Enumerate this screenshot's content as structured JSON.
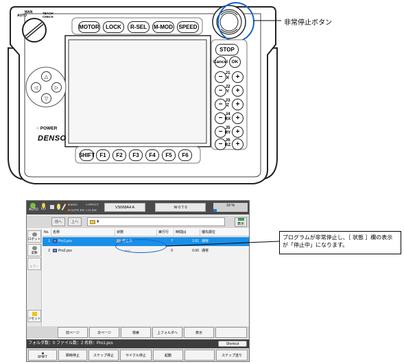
{
  "pendant": {
    "top_keys": [
      "MOTOR",
      "LOCK",
      "R-SEL",
      "M-MOD",
      "SPEED"
    ],
    "fkeys": [
      "SHIFT",
      "F1",
      "F2",
      "F3",
      "F4",
      "F5",
      "F6"
    ],
    "stop": "STOP",
    "cancel": "Cancel",
    "ok": "OK",
    "jog_labels": [
      "J1\nX",
      "J2\nY",
      "J3\nZ",
      "J4\nRX",
      "J5\nRY",
      "J6\nRZ"
    ],
    "power_label": "POWER",
    "brand": "DENSO",
    "mode_labels": {
      "manual": "MAN",
      "auto": "AUTO",
      "teach": "TEACH CHECK"
    },
    "emergency_callout": "非常停止ボタン"
  },
  "screen": {
    "topbar": {
      "auto_label": "AUTO",
      "io_label": "I/O",
      "status": {
        "eng": "ENG",
        "auto_en": "AUTO EN",
        "protect": "PRTCT",
        "dsw": "D.SW"
      },
      "robot_model": "VS068A4 A",
      "tool_work": "W 0 T 0",
      "speed": "10 %",
      "speed_value": 10
    },
    "nav": {
      "back_label": "前へ",
      "up_label": "上へ",
      "path": "¥",
      "display_label": "表示"
    },
    "sidebar": {
      "robot_label": "ロボット",
      "var_label": "変数",
      "error_label": "エラー",
      "reset_label": "リセット"
    },
    "table": {
      "columns": [
        "No.",
        "名称",
        "状態",
        "実行行",
        "時間[s]",
        "優先順位"
      ],
      "rows": [
        {
          "no": "1",
          "name": "Pro1.pcs",
          "state": "停止中",
          "line": "7",
          "time": "2.61",
          "priority": "通常"
        },
        {
          "no": "2",
          "name": "Pro2.pcs",
          "state": "-----",
          "line": "0",
          "time": "0.00",
          "priority": "通常"
        }
      ]
    },
    "func_buttons": [
      "前ページ",
      "次ページ",
      "検索",
      "上フォルダへ",
      "表示"
    ],
    "status_bar": {
      "text": "フォルダ数：0  ファイル数：2  名称：Pro1.pcs",
      "shortcut": "Shortcut"
    },
    "bottom_buttons": {
      "shift": "SHIFT",
      "b1": "瞬時停止",
      "b2": "ステップ停止",
      "b3": "サイクル停止",
      "b4": "起動",
      "b5": "ステップ送り"
    }
  },
  "annotation": "プログラムが非常停止し、［ 状態 ］欄の表示が「停止中」になります。"
}
